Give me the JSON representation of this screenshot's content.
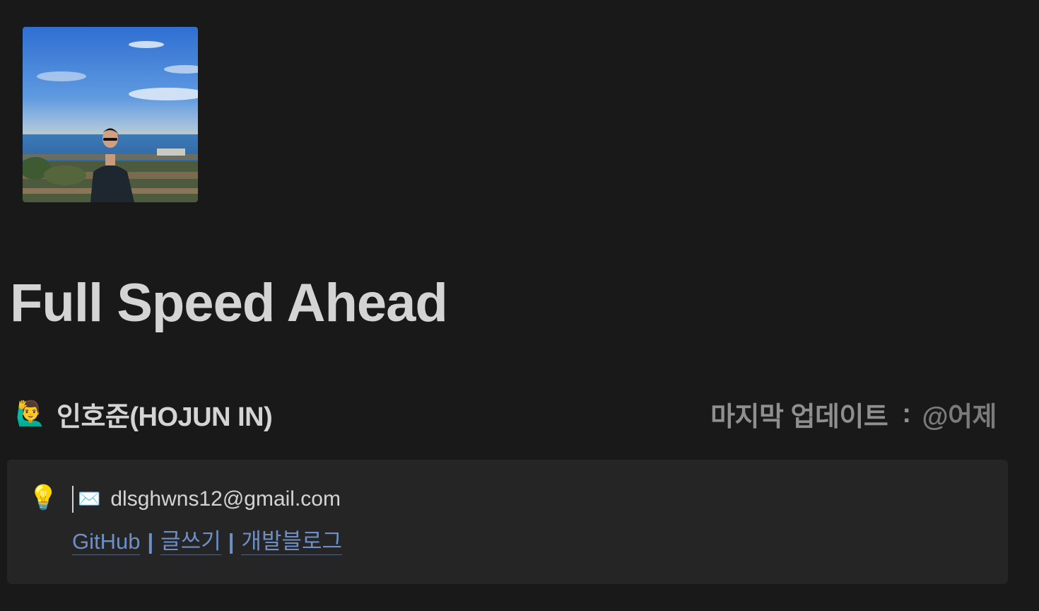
{
  "page": {
    "title": "Full Speed Ahead",
    "author": {
      "emoji": "🙋‍♂️",
      "name": "인호준(HOJUN IN)"
    },
    "last_update": {
      "label": "마지막 업데이트",
      "separator": ":",
      "value": "@어제"
    },
    "callout": {
      "icon": "💡",
      "mail_icon": "✉️",
      "email": "dlsghwns12@gmail.com",
      "links": [
        {
          "label": "GitHub"
        },
        {
          "label": "글쓰기"
        },
        {
          "label": "개발블로그"
        }
      ],
      "link_separator": "|"
    }
  },
  "colors": {
    "background": "#191919",
    "callout_bg": "#252525",
    "text": "#d4d4d4",
    "muted": "#8f8f8f",
    "link": "#6f8fc4"
  }
}
